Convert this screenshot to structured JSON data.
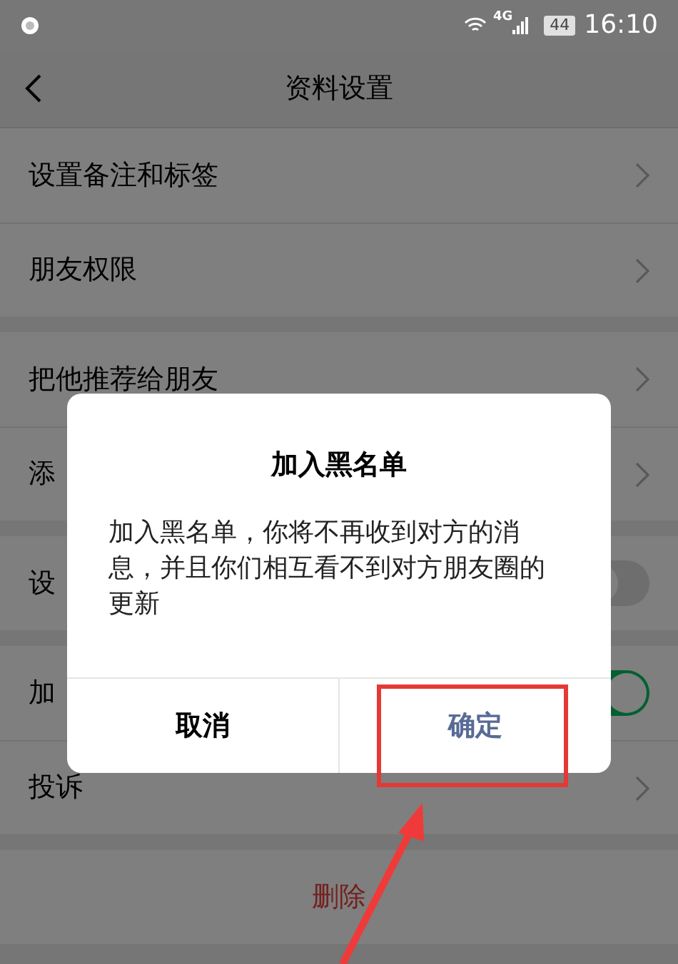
{
  "status_bar": {
    "network": "4G",
    "battery": "44",
    "time": "16:10"
  },
  "nav": {
    "title": "资料设置"
  },
  "sections": [
    {
      "items": [
        {
          "kind": "link",
          "label": "设置备注和标签"
        },
        {
          "kind": "link",
          "label": "朋友权限"
        }
      ]
    },
    {
      "items": [
        {
          "kind": "link",
          "label": "把他推荐给朋友"
        },
        {
          "kind": "link",
          "label": "添"
        }
      ]
    },
    {
      "items": [
        {
          "kind": "toggle",
          "label": "设",
          "on": false
        }
      ]
    },
    {
      "items": [
        {
          "kind": "toggle",
          "label": "加",
          "on": true
        },
        {
          "kind": "link",
          "label": "投诉"
        }
      ]
    },
    {
      "items": [
        {
          "kind": "danger",
          "label": "删除"
        }
      ]
    }
  ],
  "dialog": {
    "title": "加入黑名单",
    "message": "加入黑名单，你将不再收到对方的消息，并且你们相互看不到对方朋友圈的更新",
    "buttons": [
      {
        "kind": "cancel",
        "label": "取消"
      },
      {
        "kind": "confirm",
        "label": "确定"
      }
    ]
  }
}
